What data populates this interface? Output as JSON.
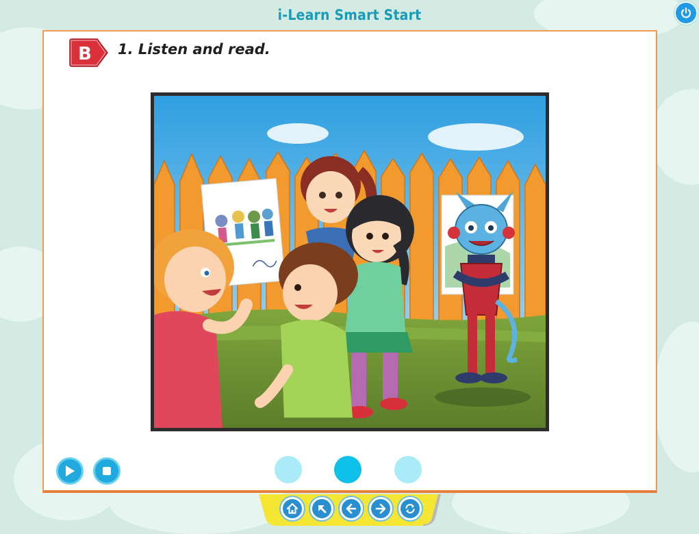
{
  "app": {
    "title": "i-Learn Smart Start"
  },
  "section": {
    "badge_letter": "B",
    "instruction": "1. Listen and read."
  },
  "colors": {
    "accent": "#1fa9dc",
    "panel_border": "#f09a55",
    "badge_red": "#d9303a",
    "nav_yellow": "#f5e633"
  },
  "player": {
    "play_icon": "play-icon",
    "stop_icon": "stop-icon",
    "pages": [
      {
        "state": "inactive"
      },
      {
        "state": "active"
      },
      {
        "state": "inactive"
      }
    ]
  },
  "nav": {
    "buttons": [
      {
        "icon": "home-icon"
      },
      {
        "icon": "arrow-up-left-icon"
      },
      {
        "icon": "arrow-left-icon"
      },
      {
        "icon": "arrow-right-icon"
      },
      {
        "icon": "refresh-icon"
      }
    ]
  }
}
